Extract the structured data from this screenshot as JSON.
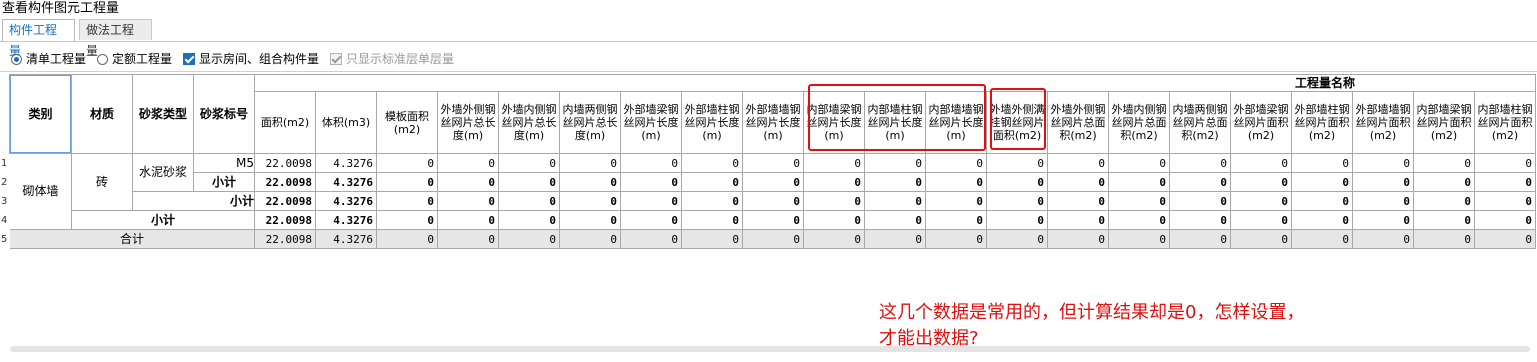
{
  "window_title": "查看构件图元工程量",
  "tabs": [
    {
      "label": "构件工程量",
      "active": true
    },
    {
      "label": "做法工程量",
      "active": false
    }
  ],
  "options": {
    "qingdan": "清单工程量",
    "dinge": "定额工程量",
    "show_rooms": "显示房间、组合构件量",
    "only_std": "只显示标准层单层量"
  },
  "group_header": "工程量名称",
  "fixed_headers": [
    "类别",
    "材质",
    "砂浆类型",
    "砂浆标号"
  ],
  "quantity_headers": [
    "面积(m2)",
    "体积(m3)",
    "模板面积(m2)",
    "外墙外侧钢丝网片总长度(m)",
    "外墙内侧钢丝网片总长度(m)",
    "内墙两侧钢丝网片总长度(m)",
    "外部墙梁钢丝网片长度(m)",
    "外部墙柱钢丝网片长度(m)",
    "外部墙墙钢丝网片长度(m)",
    "内部墙梁钢丝网片长度(m)",
    "内部墙柱钢丝网片长度(m)",
    "内部墙墙钢丝网片长度(m)",
    "外墙外侧满挂钢丝网片面积(m2)",
    "外墙外侧钢丝网片总面积(m2)",
    "外墙内侧钢丝网片总面积(m2)",
    "内墙两侧钢丝网片总面积(m2)",
    "外部墙梁钢丝网片面积(m2)",
    "外部墙柱钢丝网片面积(m2)",
    "外部墙墙钢丝网片面积(m2)",
    "内部墙梁钢丝网片面积(m2)",
    "内部墙柱钢丝网片面积(m2)"
  ],
  "rows": [
    {
      "n": "1",
      "values": [
        "22.0098",
        "4.3276",
        "0",
        "0",
        "0",
        "0",
        "0",
        "0",
        "0",
        "0",
        "0",
        "0",
        "0",
        "0",
        "0",
        "0",
        "0",
        "0",
        "0",
        "0",
        "0"
      ]
    },
    {
      "n": "2",
      "values": [
        "22.0098",
        "4.3276",
        "0",
        "0",
        "0",
        "0",
        "0",
        "0",
        "0",
        "0",
        "0",
        "0",
        "0",
        "0",
        "0",
        "0",
        "0",
        "0",
        "0",
        "0",
        "0"
      ]
    },
    {
      "n": "3",
      "values": [
        "22.0098",
        "4.3276",
        "0",
        "0",
        "0",
        "0",
        "0",
        "0",
        "0",
        "0",
        "0",
        "0",
        "0",
        "0",
        "0",
        "0",
        "0",
        "0",
        "0",
        "0",
        "0"
      ]
    },
    {
      "n": "4",
      "values": [
        "22.0098",
        "4.3276",
        "0",
        "0",
        "0",
        "0",
        "0",
        "0",
        "0",
        "0",
        "0",
        "0",
        "0",
        "0",
        "0",
        "0",
        "0",
        "0",
        "0",
        "0",
        "0"
      ]
    },
    {
      "n": "5",
      "values": [
        "22.0098",
        "4.3276",
        "0",
        "0",
        "0",
        "0",
        "0",
        "0",
        "0",
        "0",
        "0",
        "0",
        "0",
        "0",
        "0",
        "0",
        "0",
        "0",
        "0",
        "0",
        "0"
      ]
    }
  ],
  "labels": {
    "category": "砌体墙",
    "material": "砖",
    "mortar_type": "水泥砂浆",
    "mortar_grade": "M5",
    "subtotal": "小计",
    "total": "合计"
  },
  "annotation": {
    "line1": "这几个数据是常用的，但计算结果却是0，怎样设置，",
    "line2": "才能出数据?",
    "color": "#e01010"
  }
}
